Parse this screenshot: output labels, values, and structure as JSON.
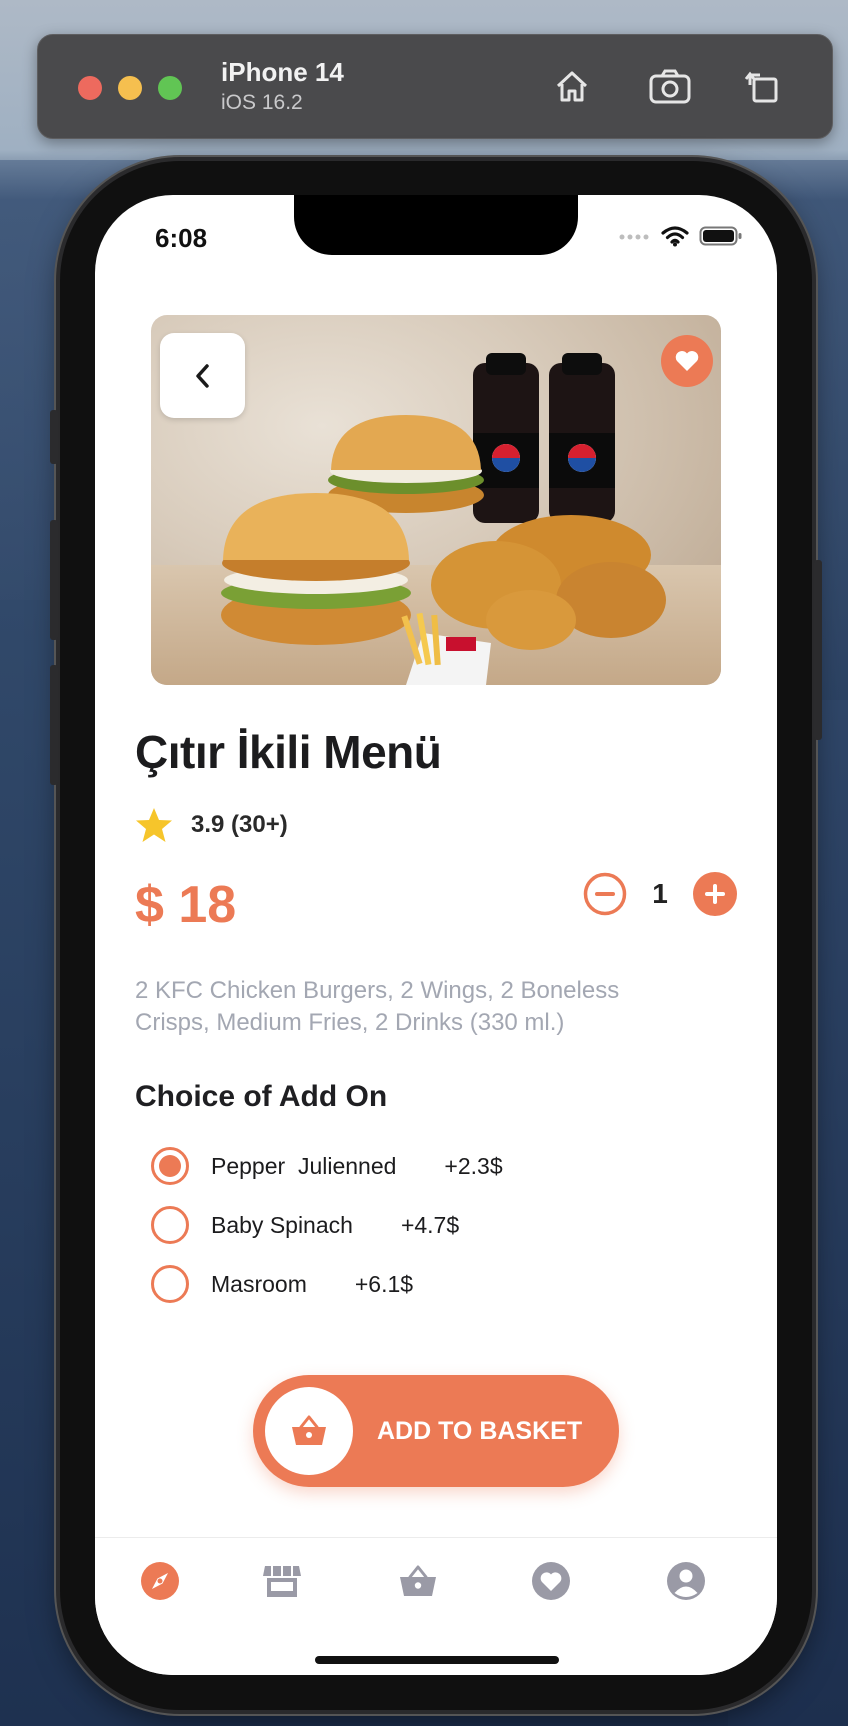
{
  "simulator": {
    "device_name": "iPhone 14",
    "os_version": "iOS 16.2",
    "icons": [
      "home-icon",
      "screenshot-icon",
      "rotate-icon"
    ]
  },
  "status_bar": {
    "time": "6:08",
    "icons": [
      "signal-icon",
      "wifi-icon",
      "battery-icon"
    ]
  },
  "product": {
    "title": "Çıtır İkili Menü",
    "rating": "3.9 (30+)",
    "price": "$ 18",
    "quantity": "1",
    "description": "2 KFC Chicken Burgers, 2 Wings, 2 Boneless Crisps, Medium Fries, 2 Drinks (330 ml.)"
  },
  "addons": {
    "heading": "Choice of Add On",
    "items": [
      {
        "name": "Pepper  Julienned",
        "price": "+2.3$",
        "selected": true
      },
      {
        "name": "Baby Spinach",
        "price": "+4.7$",
        "selected": false
      },
      {
        "name": "Masroom",
        "price": "+6.1$",
        "selected": false
      }
    ]
  },
  "basket_button": {
    "label": "ADD TO BASKET"
  },
  "tabbar": {
    "items": [
      "compass-icon",
      "store-icon",
      "basket-icon",
      "heart-icon",
      "profile-icon"
    ],
    "active": "compass-icon"
  },
  "colors": {
    "accent": "#ec7a55",
    "text_dark": "#1c1c1e",
    "text_muted": "#a3a7b2",
    "tab_inactive": "#9a9aa6"
  }
}
